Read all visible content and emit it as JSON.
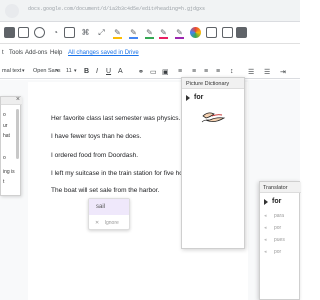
{
  "browser": {
    "url": "docs.google.com/document/d/1a2b3c4d5e/edit#heading=h.gjdgxs"
  },
  "colors": {
    "accent": "#1a73e8",
    "suggestion_bg": "#efe8fb"
  },
  "extensions": [
    "doc-icon",
    "present-icon",
    "comment-icon",
    "hear-icon",
    "speech-icon",
    "word-prediction-icon",
    "screenshot-icon",
    "shuffle-icon",
    "highlight-yellow-icon",
    "highlight-blue-icon",
    "highlight-green-icon",
    "highlight-pink-icon",
    "highlight-purple-icon",
    "rainbow-icon",
    "vocab-icon",
    "check-icon",
    "translate-icon"
  ],
  "menu": {
    "items": [
      "t",
      "Tools",
      "Add-ons",
      "Help"
    ],
    "saved": "All changes saved in Drive"
  },
  "format": {
    "style": "mal text",
    "font": "Open Sans",
    "size": "11"
  },
  "left_panel": {
    "lines": [
      "o",
      "ur",
      "hat",
      "",
      "o",
      "ing is",
      "t"
    ]
  },
  "document": {
    "lines": [
      "Her favorite class last semester was physics.",
      "I have fewer toys than he does.",
      "I ordered food from Doordash.",
      "I left my suitcase in the train station for five hour",
      "The boat will set sale from the harbor."
    ]
  },
  "suggestion": {
    "option": "sail",
    "ignore": "Ignore"
  },
  "picture_dictionary": {
    "title": "Picture Dictionary",
    "word": "for"
  },
  "translator": {
    "title": "Translator",
    "word": "for",
    "translations": [
      "para",
      "por",
      "pues",
      "por"
    ]
  }
}
